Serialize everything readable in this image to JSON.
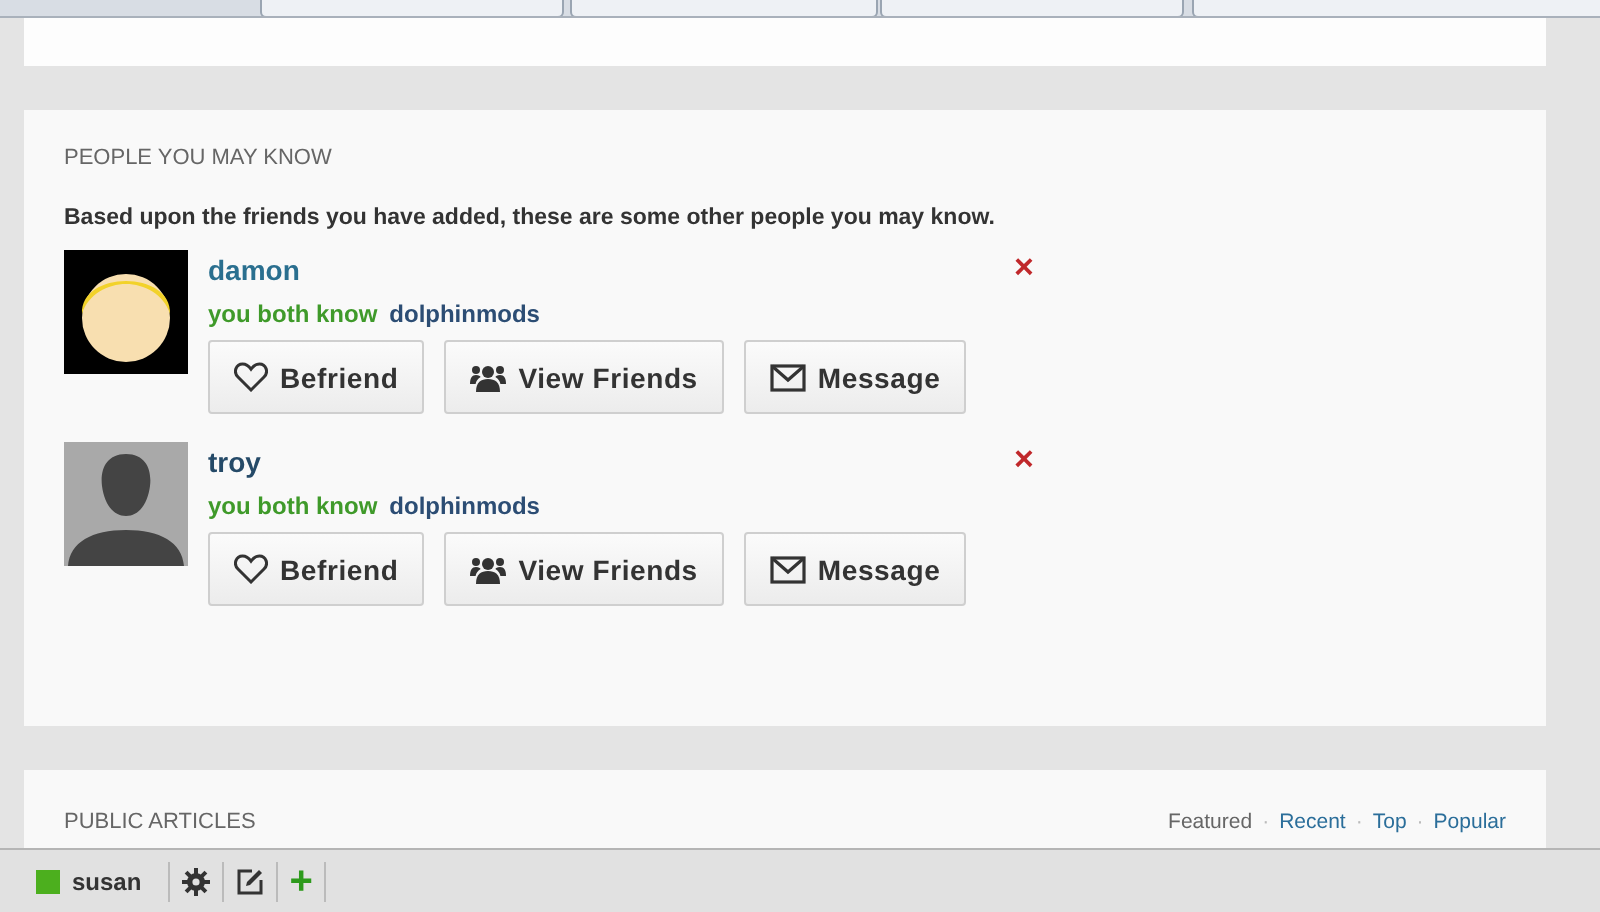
{
  "people_section": {
    "title": "PEOPLE YOU MAY KNOW",
    "intro": "Based upon the friends you have added, these are some other people you may know.",
    "people": [
      {
        "name": "damon",
        "avatar": {
          "kind": "cartoon"
        },
        "mutual_label": "you both know",
        "mutual_friend": "dolphinmods",
        "actions": [
          "Befriend",
          "View Friends",
          "Message"
        ],
        "dismiss": "×"
      },
      {
        "name": "troy",
        "avatar": {
          "kind": "silhouette"
        },
        "mutual_label": "you both know",
        "mutual_friend": "dolphinmods",
        "actions": [
          "Befriend",
          "View Friends",
          "Message"
        ],
        "dismiss": "×"
      }
    ]
  },
  "articles_section": {
    "title": "PUBLIC ARTICLES",
    "filters": [
      {
        "label": "Featured",
        "selected": true
      },
      {
        "label": "Recent",
        "selected": false
      },
      {
        "label": "Top",
        "selected": false
      },
      {
        "label": "Popular",
        "selected": false
      }
    ],
    "separator": "·"
  },
  "bottom_bar": {
    "user": "susan",
    "add": "+"
  }
}
